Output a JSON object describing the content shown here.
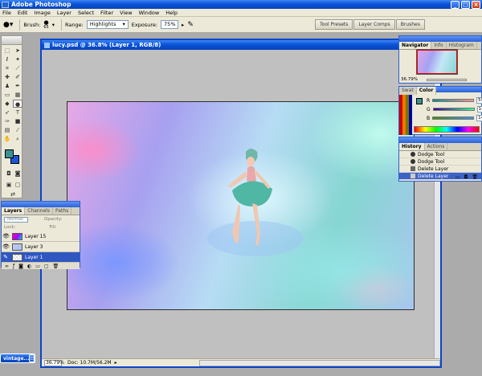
{
  "app": {
    "title": "Adobe Photoshop"
  },
  "menu": [
    "File",
    "Edit",
    "Image",
    "Layer",
    "Select",
    "Filter",
    "View",
    "Window",
    "Help"
  ],
  "options": {
    "brush_label": "Brush:",
    "brush_size": "65",
    "range_label": "Range:",
    "range_value": "Highlights",
    "exposure_label": "Exposure:",
    "exposure_value": "75%"
  },
  "wells": [
    "Tool Presets",
    "Layer Comps",
    "Brushes"
  ],
  "document": {
    "title": "lucy.psd @ 36.8% (Layer 1, RGB/8)",
    "zoom": "36.79%",
    "doc_info": "Doc: 10.7M/56.2M"
  },
  "navigator": {
    "tabs": [
      "Navigator",
      "Info",
      "Histogram"
    ],
    "zoom": "36.79%"
  },
  "color": {
    "tabs": [
      "Swat",
      "Color"
    ],
    "rows": [
      {
        "label": "R",
        "value": "59"
      },
      {
        "label": "G",
        "value": "146"
      },
      {
        "label": "B",
        "value": "146"
      }
    ]
  },
  "history": {
    "tabs": [
      "History",
      "Actions"
    ],
    "items": [
      "Dodge Tool",
      "Dodge Tool",
      "Delete Layer",
      "Delete Layer"
    ]
  },
  "layers": {
    "tabs": [
      "Layers",
      "Channels",
      "Paths"
    ],
    "blend_mode": "Normal",
    "opacity_label": "Opacity:",
    "fill_label": "Fill:",
    "lock_label": "Lock:",
    "items": [
      "Layer 15",
      "Layer 3",
      "Layer 1"
    ]
  },
  "taskbar": {
    "button_label": "vintage..."
  },
  "colors": {
    "title_bar": "#0a53d8",
    "selection": "#2f57c0",
    "panel": "#ece9d8"
  }
}
